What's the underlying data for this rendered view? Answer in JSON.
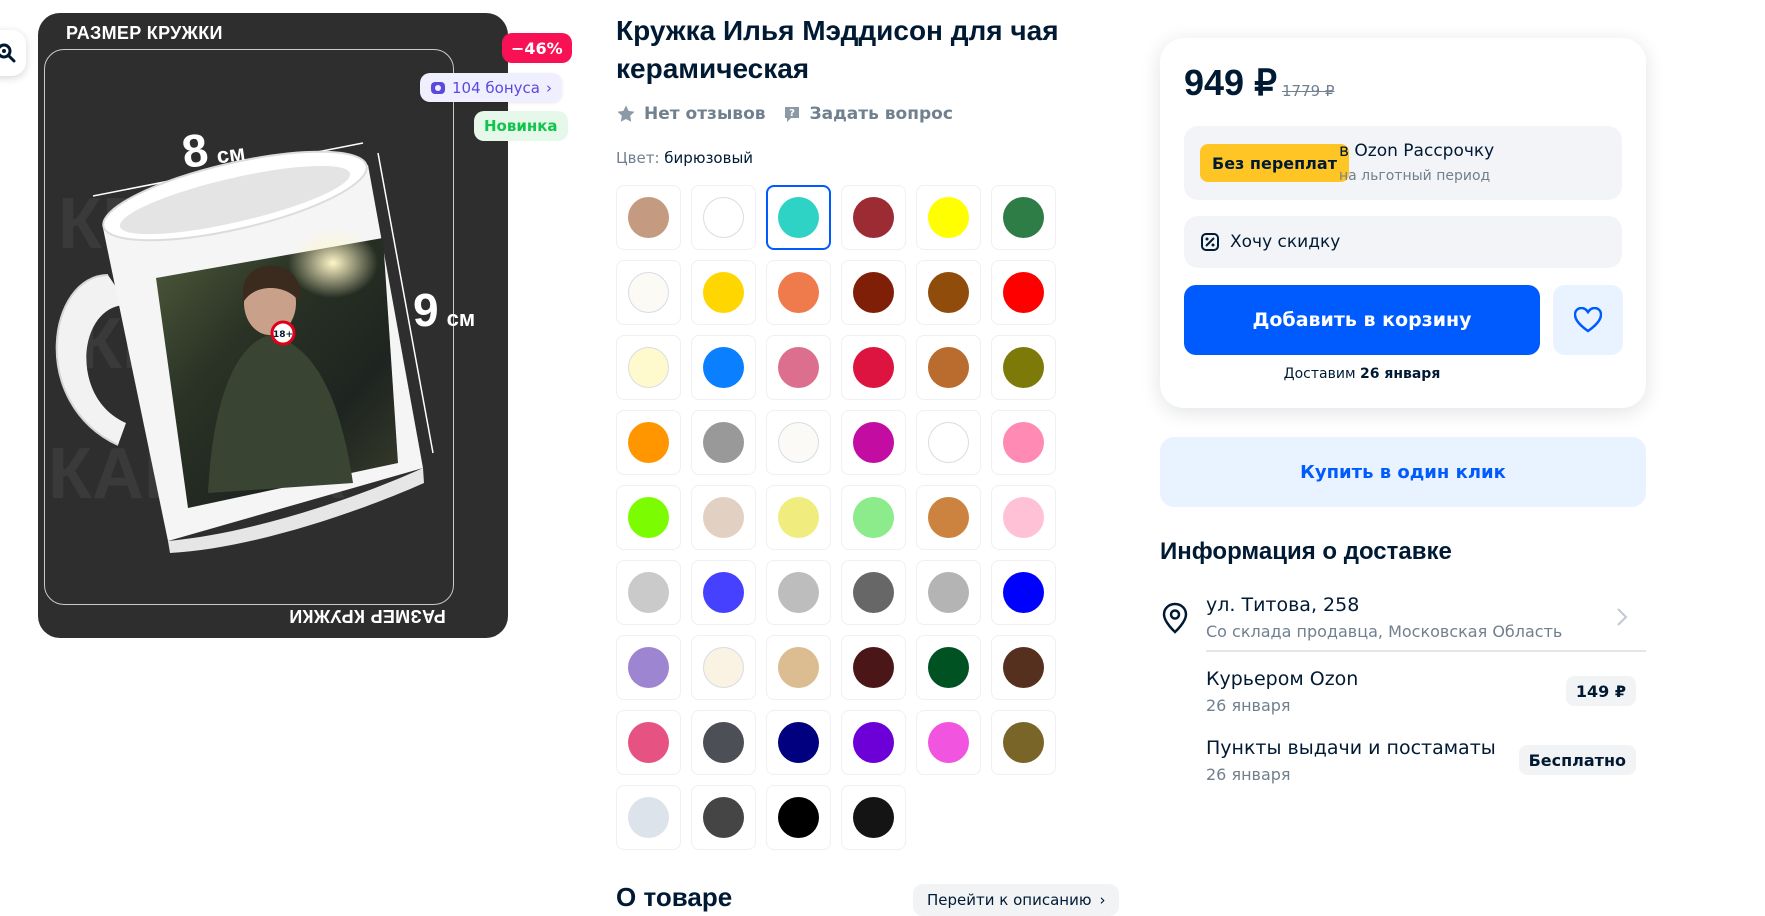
{
  "gallery": {
    "size_title": "РАЗМЕР КРУЖКИ",
    "size_title_bottom": "РАЗМЕР КРУЖКИ",
    "width_value": "8",
    "width_unit": "см",
    "height_value": "9",
    "height_unit": "см",
    "age_badge": "18+"
  },
  "badges": {
    "discount": "−46%",
    "bonus": "104 бонуса",
    "new": "Новинка"
  },
  "product": {
    "title": "Кружка Илья Мэддисон для чая керамическая",
    "reviews": "Нет отзывов",
    "ask": "Задать вопрос",
    "color_label": "Цвет:",
    "color_value": "бирюзовый",
    "selected_index": 2,
    "swatches": [
      "#c49a80",
      "#ffffff",
      "#2ed3c6",
      "#9c2b34",
      "#ffff00",
      "#2e7d46",
      "#fbfaf5",
      "#ffd600",
      "#ef7a4c",
      "#7f1f08",
      "#8f4c0a",
      "#ff0000",
      "#fffacd",
      "#0a7fff",
      "#dc6f8e",
      "#dd1340",
      "#b96c2e",
      "#7d7a0a",
      "#ff9600",
      "#999999",
      "#fbfaf6",
      "#c30ca2",
      "#ffffff",
      "#ff8ab3",
      "#7cfc00",
      "#e2d0c2",
      "#f0ec7e",
      "#8ceb8a",
      "#cd8340",
      "#ffc1d5",
      "#cacaca",
      "#4641ff",
      "#bdbdbd",
      "#676767",
      "#b4b4b4",
      "#0000ff",
      "#9e85d2",
      "#faf2e3",
      "#dcbc91",
      "#4b1617",
      "#005222",
      "#56301f",
      "#e65282",
      "#4c4f56",
      "#01017f",
      "#6c00d6",
      "#f155e0",
      "#7a6528",
      "#dde3ea",
      "#454545",
      "#000000",
      "#141414"
    ]
  },
  "about": {
    "title": "О товаре",
    "link": "Перейти к описанию"
  },
  "price_card": {
    "price": "949 ₽",
    "old_price": "1779 ₽",
    "installment_pill": "Без переплат",
    "installment_line1": "в Ozon Рассрочку",
    "installment_line2": "на льготный период",
    "want_discount": "Хочу скидку",
    "add_to_cart": "Добавить в корзину",
    "delivery_prefix": "Доставим",
    "delivery_date": "26 января"
  },
  "one_click": "Купить в один клик",
  "delivery": {
    "title": "Информация о доставке",
    "address": "ул. Титова, 258",
    "address_sub": "Со склада продавца, Московская Область",
    "options": [
      {
        "name": "Курьером Ozon",
        "date": "26 января",
        "price": "149 ₽"
      },
      {
        "name": "Пункты выдачи и постаматы",
        "date": "26 января",
        "price": "Бесплатно"
      }
    ]
  },
  "colors": {
    "accent": "#005bff",
    "discount": "#f91155",
    "bonus": "#5b49df",
    "new": "#10c44c",
    "installment": "#ffc525"
  }
}
